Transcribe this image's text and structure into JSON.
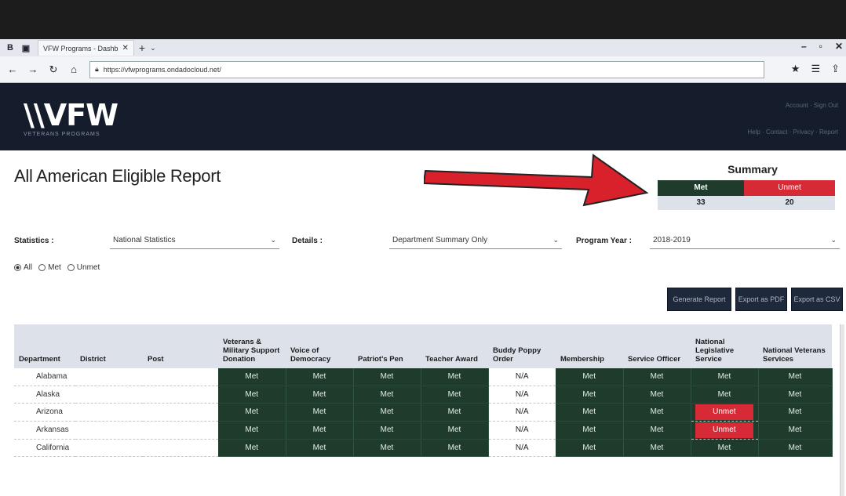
{
  "browser": {
    "tab_title": "VFW Programs - Dashb",
    "tab_close": "✕",
    "url": "https://vfwprograms.ondadocloud.net/",
    "new_tab": "+",
    "tab_menu": "⌄",
    "win_minimize": "–",
    "win_maximize": "▫",
    "win_close": "✕"
  },
  "header": {
    "logo": "\\\\VFW",
    "logo_sub": "VETERANS PROGRAMS",
    "link_1": "Account · Sign Out",
    "link_2": "Help · Contact · Privacy · Report"
  },
  "page": {
    "title": "All American Eligible Report"
  },
  "summary": {
    "title": "Summary",
    "met_label": "Met",
    "unmet_label": "Unmet",
    "met_count": "33",
    "unmet_count": "20"
  },
  "filters": {
    "statistics_label": "Statistics :",
    "statistics_value": "National Statistics",
    "details_label": "Details :",
    "details_value": "Department Summary Only",
    "program_year_label": "Program Year :",
    "program_year_value": "2018-2019",
    "radio_all": "All",
    "radio_met": "Met",
    "radio_unmet": "Unmet",
    "selected_radio": "All"
  },
  "buttons": {
    "generate": "Generate Report",
    "export_pdf": "Export as PDF",
    "export_csv": "Export as CSV"
  },
  "table": {
    "columns": [
      "Department",
      "District",
      "Post",
      "Veterans & Military Support Donation",
      "Voice of Democracy",
      "Patriot's Pen",
      "Teacher Award",
      "Buddy Poppy Order",
      "Membership",
      "Service Officer",
      "National Legislative Service",
      "National Veterans Services"
    ],
    "rows": [
      {
        "department": "Alabama",
        "district": "",
        "post": "",
        "cells": [
          "Met",
          "Met",
          "Met",
          "Met",
          "N/A",
          "Met",
          "Met",
          "Met",
          "Met"
        ]
      },
      {
        "department": "Alaska",
        "district": "",
        "post": "",
        "cells": [
          "Met",
          "Met",
          "Met",
          "Met",
          "N/A",
          "Met",
          "Met",
          "Met",
          "Met"
        ]
      },
      {
        "department": "Arizona",
        "district": "",
        "post": "",
        "cells": [
          "Met",
          "Met",
          "Met",
          "Met",
          "N/A",
          "Met",
          "Met",
          "Unmet",
          "Met"
        ]
      },
      {
        "department": "Arkansas",
        "district": "",
        "post": "",
        "cells": [
          "Met",
          "Met",
          "Met",
          "Met",
          "N/A",
          "Met",
          "Met",
          "Unmet",
          "Met"
        ]
      },
      {
        "department": "California",
        "district": "",
        "post": "",
        "cells": [
          "Met",
          "Met",
          "Met",
          "Met",
          "N/A",
          "Met",
          "Met",
          "Met",
          "Met"
        ]
      }
    ]
  },
  "colors": {
    "met": "#1e3b2c",
    "unmet": "#d62b36",
    "header_bg": "#151d2c",
    "annotation_arrow": "#d9212c"
  },
  "icons": [
    "back-icon",
    "forward-icon",
    "refresh-icon",
    "home-icon",
    "lock-icon",
    "star-icon",
    "favorites-icon",
    "share-icon",
    "caret-down-icon"
  ]
}
